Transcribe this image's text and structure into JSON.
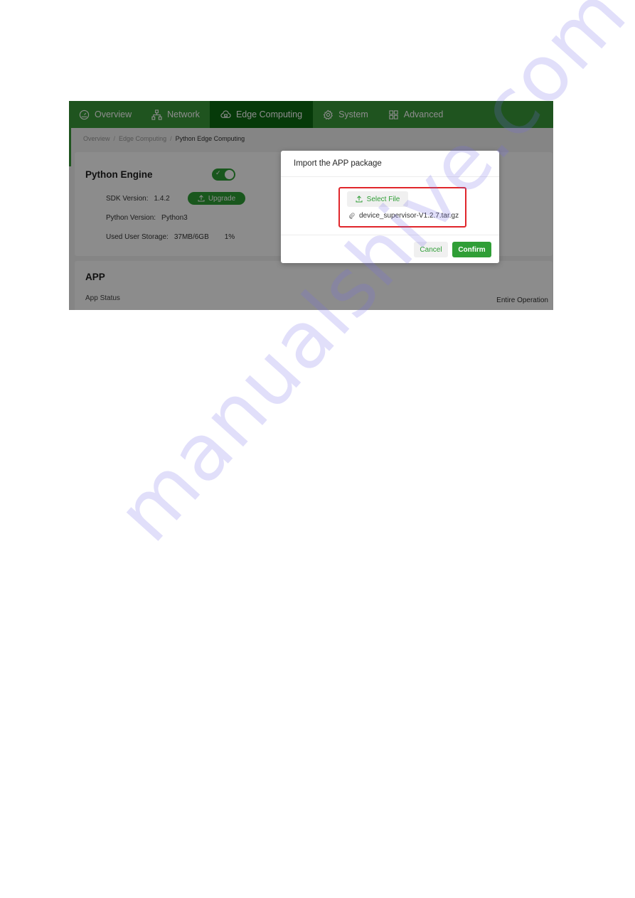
{
  "nav": {
    "items": [
      {
        "label": "Overview",
        "icon": "dashboard-icon",
        "active": false
      },
      {
        "label": "Network",
        "icon": "network-icon",
        "active": false
      },
      {
        "label": "Edge Computing",
        "icon": "cloud-chip-icon",
        "active": true
      },
      {
        "label": "System",
        "icon": "gear-icon",
        "active": false
      },
      {
        "label": "Advanced",
        "icon": "grid-icon",
        "active": false
      }
    ]
  },
  "breadcrumb": [
    "Overview",
    "Edge Computing",
    "Python Edge Computing"
  ],
  "engine": {
    "title": "Python Engine",
    "enabled": true,
    "sdk_label": "SDK Version:",
    "sdk_value": "1.4.2",
    "upgrade_label": "Upgrade",
    "python_label": "Python Version:",
    "python_value": "Python3",
    "storage_label": "Used User Storage:",
    "storage_value": "37MB/6GB",
    "storage_percent": "1%"
  },
  "app": {
    "title": "APP",
    "status_label": "App Status",
    "entire_operation": "Entire Operation"
  },
  "modal": {
    "title": "Import the APP package",
    "select_file_label": "Select File",
    "file_name": "device_supervisor-V1.2.7.tar.gz",
    "cancel_label": "Cancel",
    "confirm_label": "Confirm"
  },
  "colors": {
    "brand_green": "#2f9e36",
    "active_nav": "#0b6a12",
    "highlight_red": "#e0262b"
  },
  "watermark": "manualshive.com"
}
